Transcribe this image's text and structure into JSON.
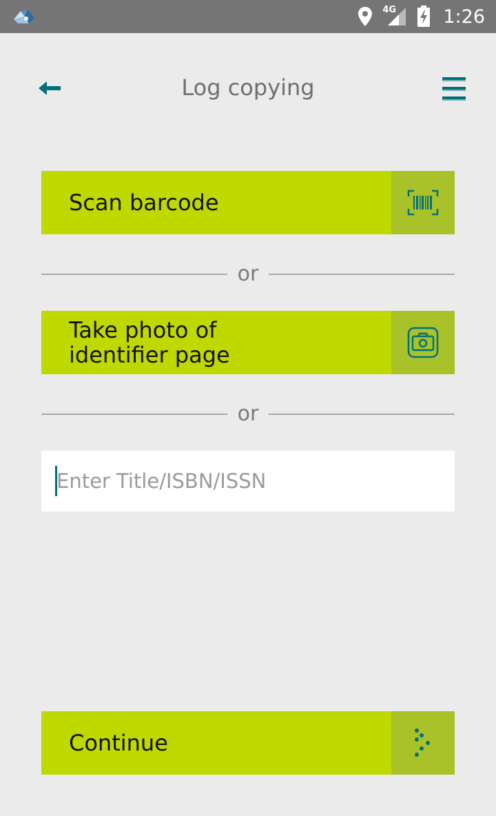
{
  "status_bar": {
    "time": "1:26",
    "network": "4G",
    "icons": [
      "app-logo-icon",
      "location-icon",
      "signal-icon",
      "battery-charging-icon"
    ]
  },
  "header": {
    "title": "Log copying",
    "back_icon": "back-arrow-icon",
    "menu_icon": "hamburger-menu-icon"
  },
  "actions": {
    "scan_barcode": {
      "label": "Scan barcode",
      "icon": "barcode-scan-icon"
    },
    "take_photo": {
      "label_line1": "Take photo of",
      "label_line2": "identifier page",
      "icon": "camera-icon"
    },
    "continue": {
      "label": "Continue",
      "icon": "dotted-arrow-icon"
    }
  },
  "dividers": {
    "or_text": "or"
  },
  "search": {
    "placeholder": "Enter Title/ISBN/ISSN",
    "value": ""
  },
  "colors": {
    "accent": "#bfd800",
    "accent_dark": "#a9c22a",
    "icon_teal": "#00707a",
    "background": "#ebebeb"
  }
}
